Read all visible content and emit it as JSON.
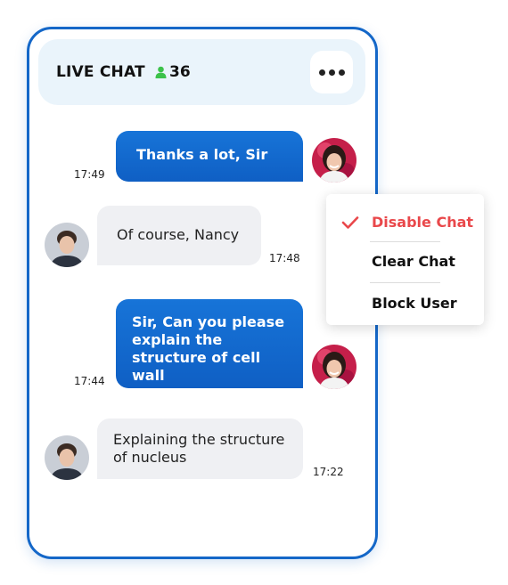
{
  "header": {
    "title": "LIVE CHAT",
    "online_count": "36",
    "menu_icon": "more-dots-icon",
    "accent_color": "#1467c8",
    "online_color": "#3cc24a"
  },
  "messages": [
    {
      "text": "Thanks a lot, Sir",
      "time": "17:49",
      "direction": "outgoing",
      "sender": "student"
    },
    {
      "text": "Of course, Nancy",
      "time": "17:48",
      "direction": "incoming",
      "sender": "teacher"
    },
    {
      "text": "Sir, Can you please explain the structure of cell wall",
      "time": "17:44",
      "direction": "outgoing",
      "sender": "student"
    },
    {
      "text": "Explaining the structure of nucleus",
      "time": "17:22",
      "direction": "incoming",
      "sender": "teacher"
    }
  ],
  "menu": {
    "items": [
      {
        "label": "Disable Chat",
        "selected": true
      },
      {
        "label": "Clear Chat",
        "selected": false
      },
      {
        "label": "Block User",
        "selected": false
      }
    ],
    "selected_color": "#e9484b"
  }
}
